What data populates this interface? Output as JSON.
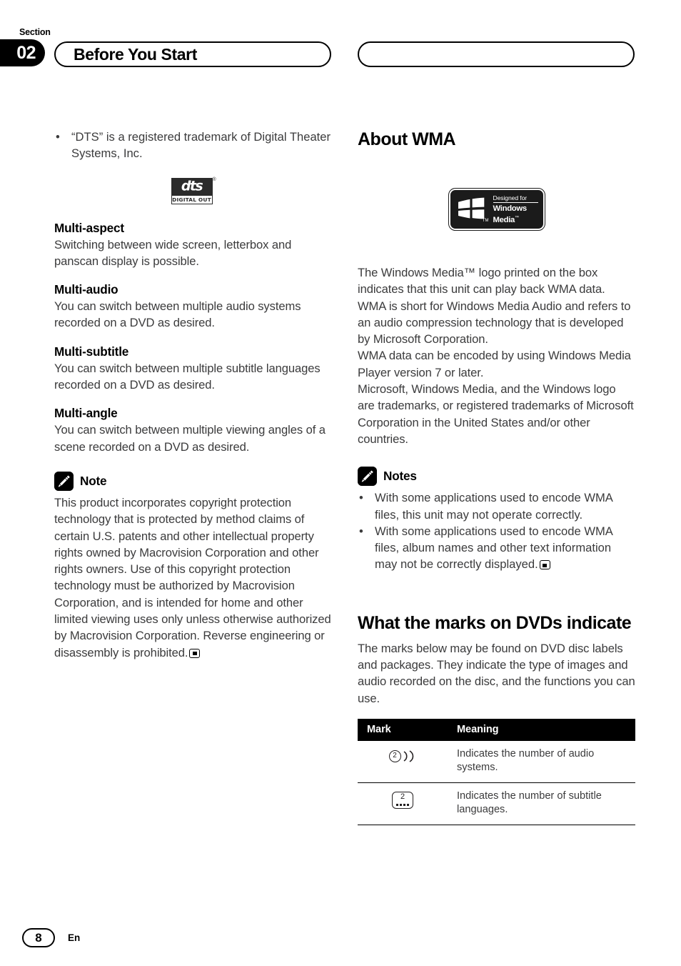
{
  "header": {
    "section_word": "Section",
    "section_number": "02",
    "left_title": "Before You Start",
    "right_title": ""
  },
  "left_column": {
    "dts_bullet": "“DTS” is a registered trademark of Digital Theater Systems, Inc.",
    "bullet_glyph": "•",
    "dts_logo": {
      "wordmark": "dts",
      "registered": "®",
      "tagline": "DIGITAL OUT"
    },
    "topics": [
      {
        "heading": "Multi-aspect",
        "body": "Switching between wide screen, letterbox and panscan display is possible."
      },
      {
        "heading": "Multi-audio",
        "body": "You can switch between multiple audio systems recorded on a DVD as desired."
      },
      {
        "heading": "Multi-subtitle",
        "body": "You can switch between multiple subtitle languages recorded on a DVD as desired."
      },
      {
        "heading": "Multi-angle",
        "body": "You can switch between multiple viewing angles of a scene recorded on a DVD as desired."
      }
    ],
    "note": {
      "label": "Note",
      "icon": "pencil-icon",
      "body": "This product incorporates copyright protection technology that is protected by method claims of certain U.S. patents and other intellectual property rights owned by Macrovision Corporation and other rights owners. Use of this copyright protection technology must be authorized by Macrovision Corporation, and is intended for home and other limited viewing uses only unless otherwise authorized by Macrovision Corporation. Reverse engineering or disassembly is prohibited."
    }
  },
  "right_column": {
    "about_wma": {
      "heading": "About WMA",
      "logo": {
        "designed_for": "Designed for",
        "brand_line1": "Windows",
        "brand_line2": "Media",
        "trademark": "™",
        "flag_tm": "TM"
      },
      "body": "The Windows Media™ logo printed on the box indicates that this unit can play back WMA data.\nWMA is short for Windows Media Audio and refers to an audio compression technology that is developed by Microsoft Corporation.\nWMA data can be encoded by using Windows Media Player version 7 or later.\nMicrosoft, Windows Media, and the Windows logo are trademarks, or registered trademarks of Microsoft Corporation in the United States and/or other countries."
    },
    "notes": {
      "label": "Notes",
      "icon": "pencil-icon",
      "bullet_glyph": "•",
      "items": [
        "With some applications used to encode WMA files, this unit may not operate correctly.",
        "With some applications used to encode WMA files, album names and other text information may not be correctly displayed."
      ]
    },
    "marks_section": {
      "heading": "What the marks on DVDs indicate",
      "body": "The marks below may be found on DVD disc labels and packages. They indicate the type of images and audio recorded on the disc, and the functions you can use.",
      "table": {
        "columns": [
          "Mark",
          "Meaning"
        ],
        "rows": [
          {
            "mark_icon": "audio-systems-mark",
            "mark_number": "2",
            "meaning": "Indicates the number of audio systems."
          },
          {
            "mark_icon": "subtitle-languages-mark",
            "mark_number": "2",
            "meaning": "Indicates the number of subtitle languages."
          }
        ]
      }
    }
  },
  "footer": {
    "page_number": "8",
    "language": "En"
  },
  "colors": {
    "ink": "#231f20",
    "body_text": "#3b3b3c",
    "accent": "#000000",
    "paper": "#ffffff"
  }
}
